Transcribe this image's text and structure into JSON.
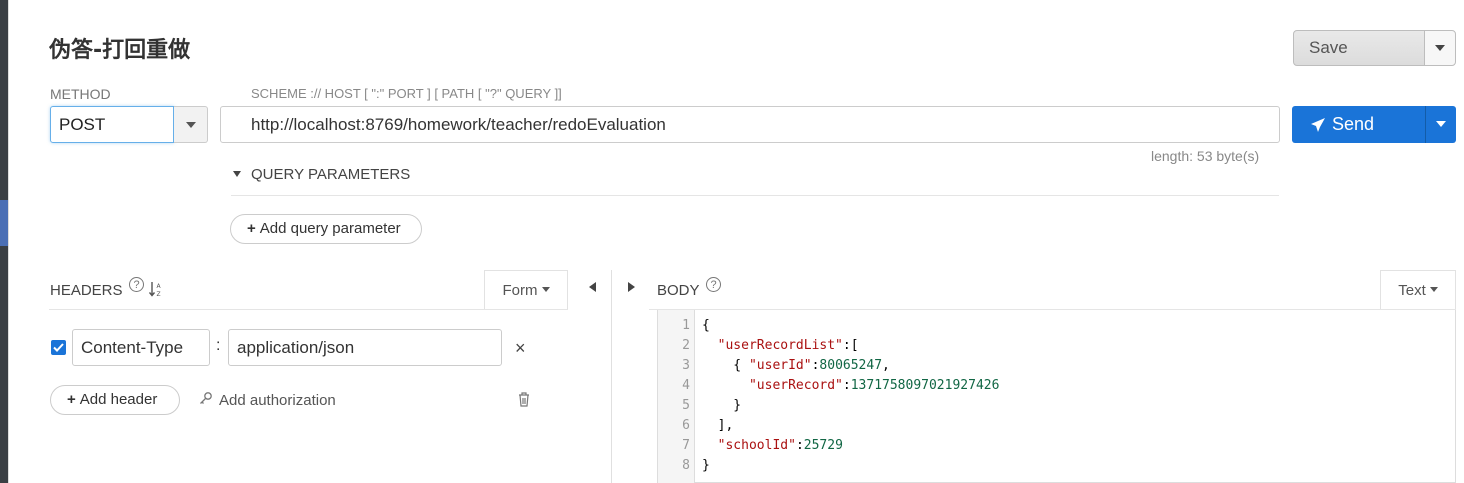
{
  "title": "伪答-打回重做",
  "save": {
    "label": "Save"
  },
  "method": {
    "label": "METHOD",
    "value": "POST"
  },
  "url": {
    "scheme_hint": "SCHEME :// HOST [ \":\" PORT ] [ PATH [ \"?\" QUERY ]]",
    "value": "http://localhost:8769/homework/teacher/redoEvaluation",
    "length": "length: 53 byte(s)"
  },
  "send": {
    "label": "Send"
  },
  "query": {
    "toggle_label": "QUERY PARAMETERS",
    "add_label": "Add query parameter"
  },
  "headers": {
    "label": "HEADERS",
    "mode": "Form",
    "rows": [
      {
        "enabled": true,
        "name": "Content-Type",
        "value": "application/json"
      }
    ],
    "add_label": "Add header",
    "auth_label": "Add authorization"
  },
  "body": {
    "label": "BODY",
    "mode": "Text",
    "line_numbers": [
      "1",
      "2",
      "3",
      "4",
      "5",
      "6",
      "7",
      "8"
    ]
  },
  "icons": {
    "send": "paper-plane-icon",
    "help": "question-circle-icon",
    "sort": "sort-alpha-icon",
    "remove": "close-icon",
    "auth": "key-icon",
    "delete": "trash-icon"
  },
  "colors": {
    "primary": "#1a74d8",
    "json_key": "#a11",
    "json_number": "#164"
  }
}
